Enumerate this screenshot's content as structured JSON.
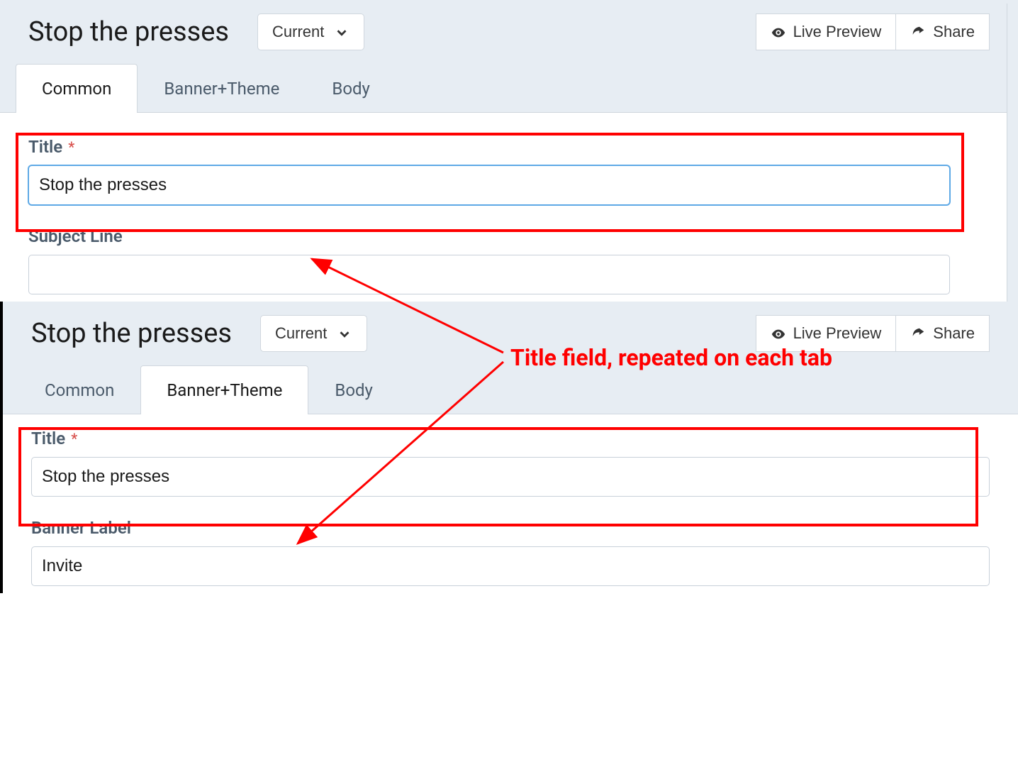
{
  "annotation": {
    "text": "Title field, repeated on each tab"
  },
  "screenshots": [
    {
      "header": {
        "title": "Stop the presses",
        "version_button": "Current",
        "actions": {
          "live_preview": "Live Preview",
          "share": "Share"
        }
      },
      "tabs": [
        {
          "label": "Common",
          "active": true
        },
        {
          "label": "Banner+Theme",
          "active": false
        },
        {
          "label": "Body",
          "active": false
        }
      ],
      "form": {
        "title": {
          "label": "Title",
          "required_symbol": "*",
          "value": "Stop the presses",
          "focused": true
        },
        "subject_line": {
          "label": "Subject Line",
          "value": ""
        }
      }
    },
    {
      "header": {
        "title": "Stop the presses",
        "version_button": "Current",
        "actions": {
          "live_preview": "Live Preview",
          "share": "Share"
        }
      },
      "tabs": [
        {
          "label": "Common",
          "active": false
        },
        {
          "label": "Banner+Theme",
          "active": true
        },
        {
          "label": "Body",
          "active": false
        }
      ],
      "form": {
        "title": {
          "label": "Title",
          "required_symbol": "*",
          "value": "Stop the presses",
          "focused": false
        },
        "banner_label": {
          "label": "Banner Label",
          "value": "Invite"
        }
      }
    }
  ]
}
